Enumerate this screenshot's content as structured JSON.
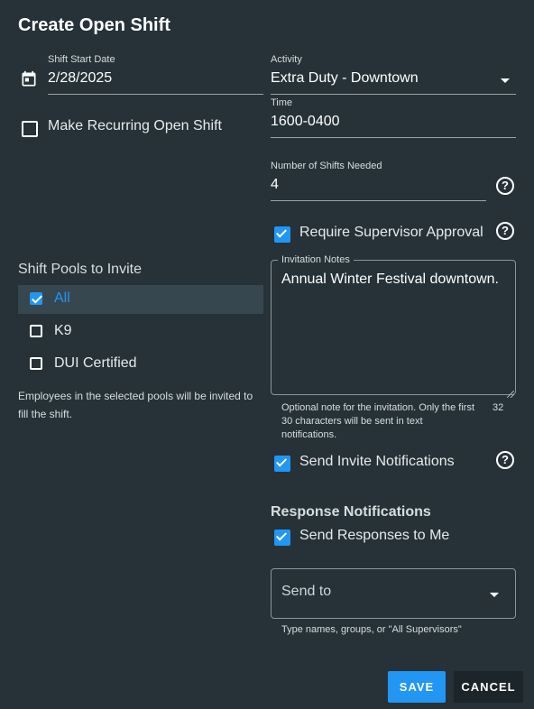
{
  "dialog": {
    "title": "Create Open Shift"
  },
  "shift_start": {
    "label": "Shift Start Date",
    "value": "2/28/2025",
    "icon": "calendar-icon"
  },
  "recurring": {
    "label": "Make Recurring Open Shift",
    "checked": false
  },
  "activity": {
    "label": "Activity",
    "value": "Extra Duty - Downtown"
  },
  "time": {
    "label": "Time",
    "value": "1600-0400"
  },
  "shifts_needed": {
    "label": "Number of Shifts Needed",
    "value": "4"
  },
  "supervisor": {
    "label": "Require Supervisor Approval",
    "checked": true
  },
  "pools": {
    "heading": "Shift Pools to Invite",
    "items": [
      {
        "label": "All",
        "checked": true
      },
      {
        "label": "K9",
        "checked": false
      },
      {
        "label": "DUI Certified",
        "checked": false
      }
    ],
    "helper": "Employees in the selected pools will be invited to fill the shift."
  },
  "notes": {
    "label": "Invitation Notes",
    "value": "Annual Winter Festival downtown.",
    "helper": "Optional note for the invitation. Only the first 30 characters will be sent in text notifications.",
    "count": "32"
  },
  "send_invite": {
    "label": "Send Invite Notifications",
    "checked": true
  },
  "response": {
    "heading": "Response Notifications",
    "send_to_me": {
      "label": "Send Responses to Me",
      "checked": true
    },
    "send_to": {
      "placeholder": "Send to",
      "helper": "Type names, groups, or \"All Supervisors\""
    }
  },
  "buttons": {
    "save": "SAVE",
    "cancel": "CANCEL"
  },
  "colors": {
    "background": "#263238",
    "accent": "#2196f3",
    "selected_row": "#37474f"
  }
}
